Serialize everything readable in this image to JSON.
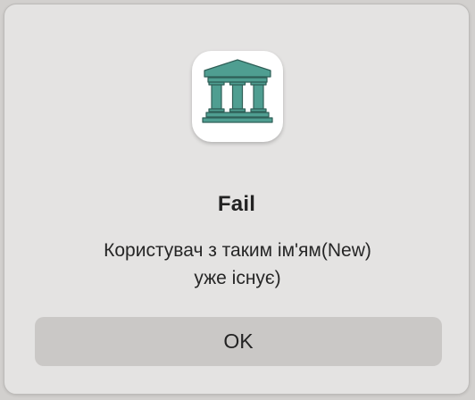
{
  "dialog": {
    "icon": "bank-building-icon",
    "title": "Fail",
    "message_line1": "Користувач з таким ім'ям(New)",
    "message_line2": "уже існує)",
    "ok_label": "OK"
  },
  "colors": {
    "icon_accent": "#4f9e91",
    "dialog_background": "#e4e3e2",
    "button_background": "#cac8c6"
  }
}
